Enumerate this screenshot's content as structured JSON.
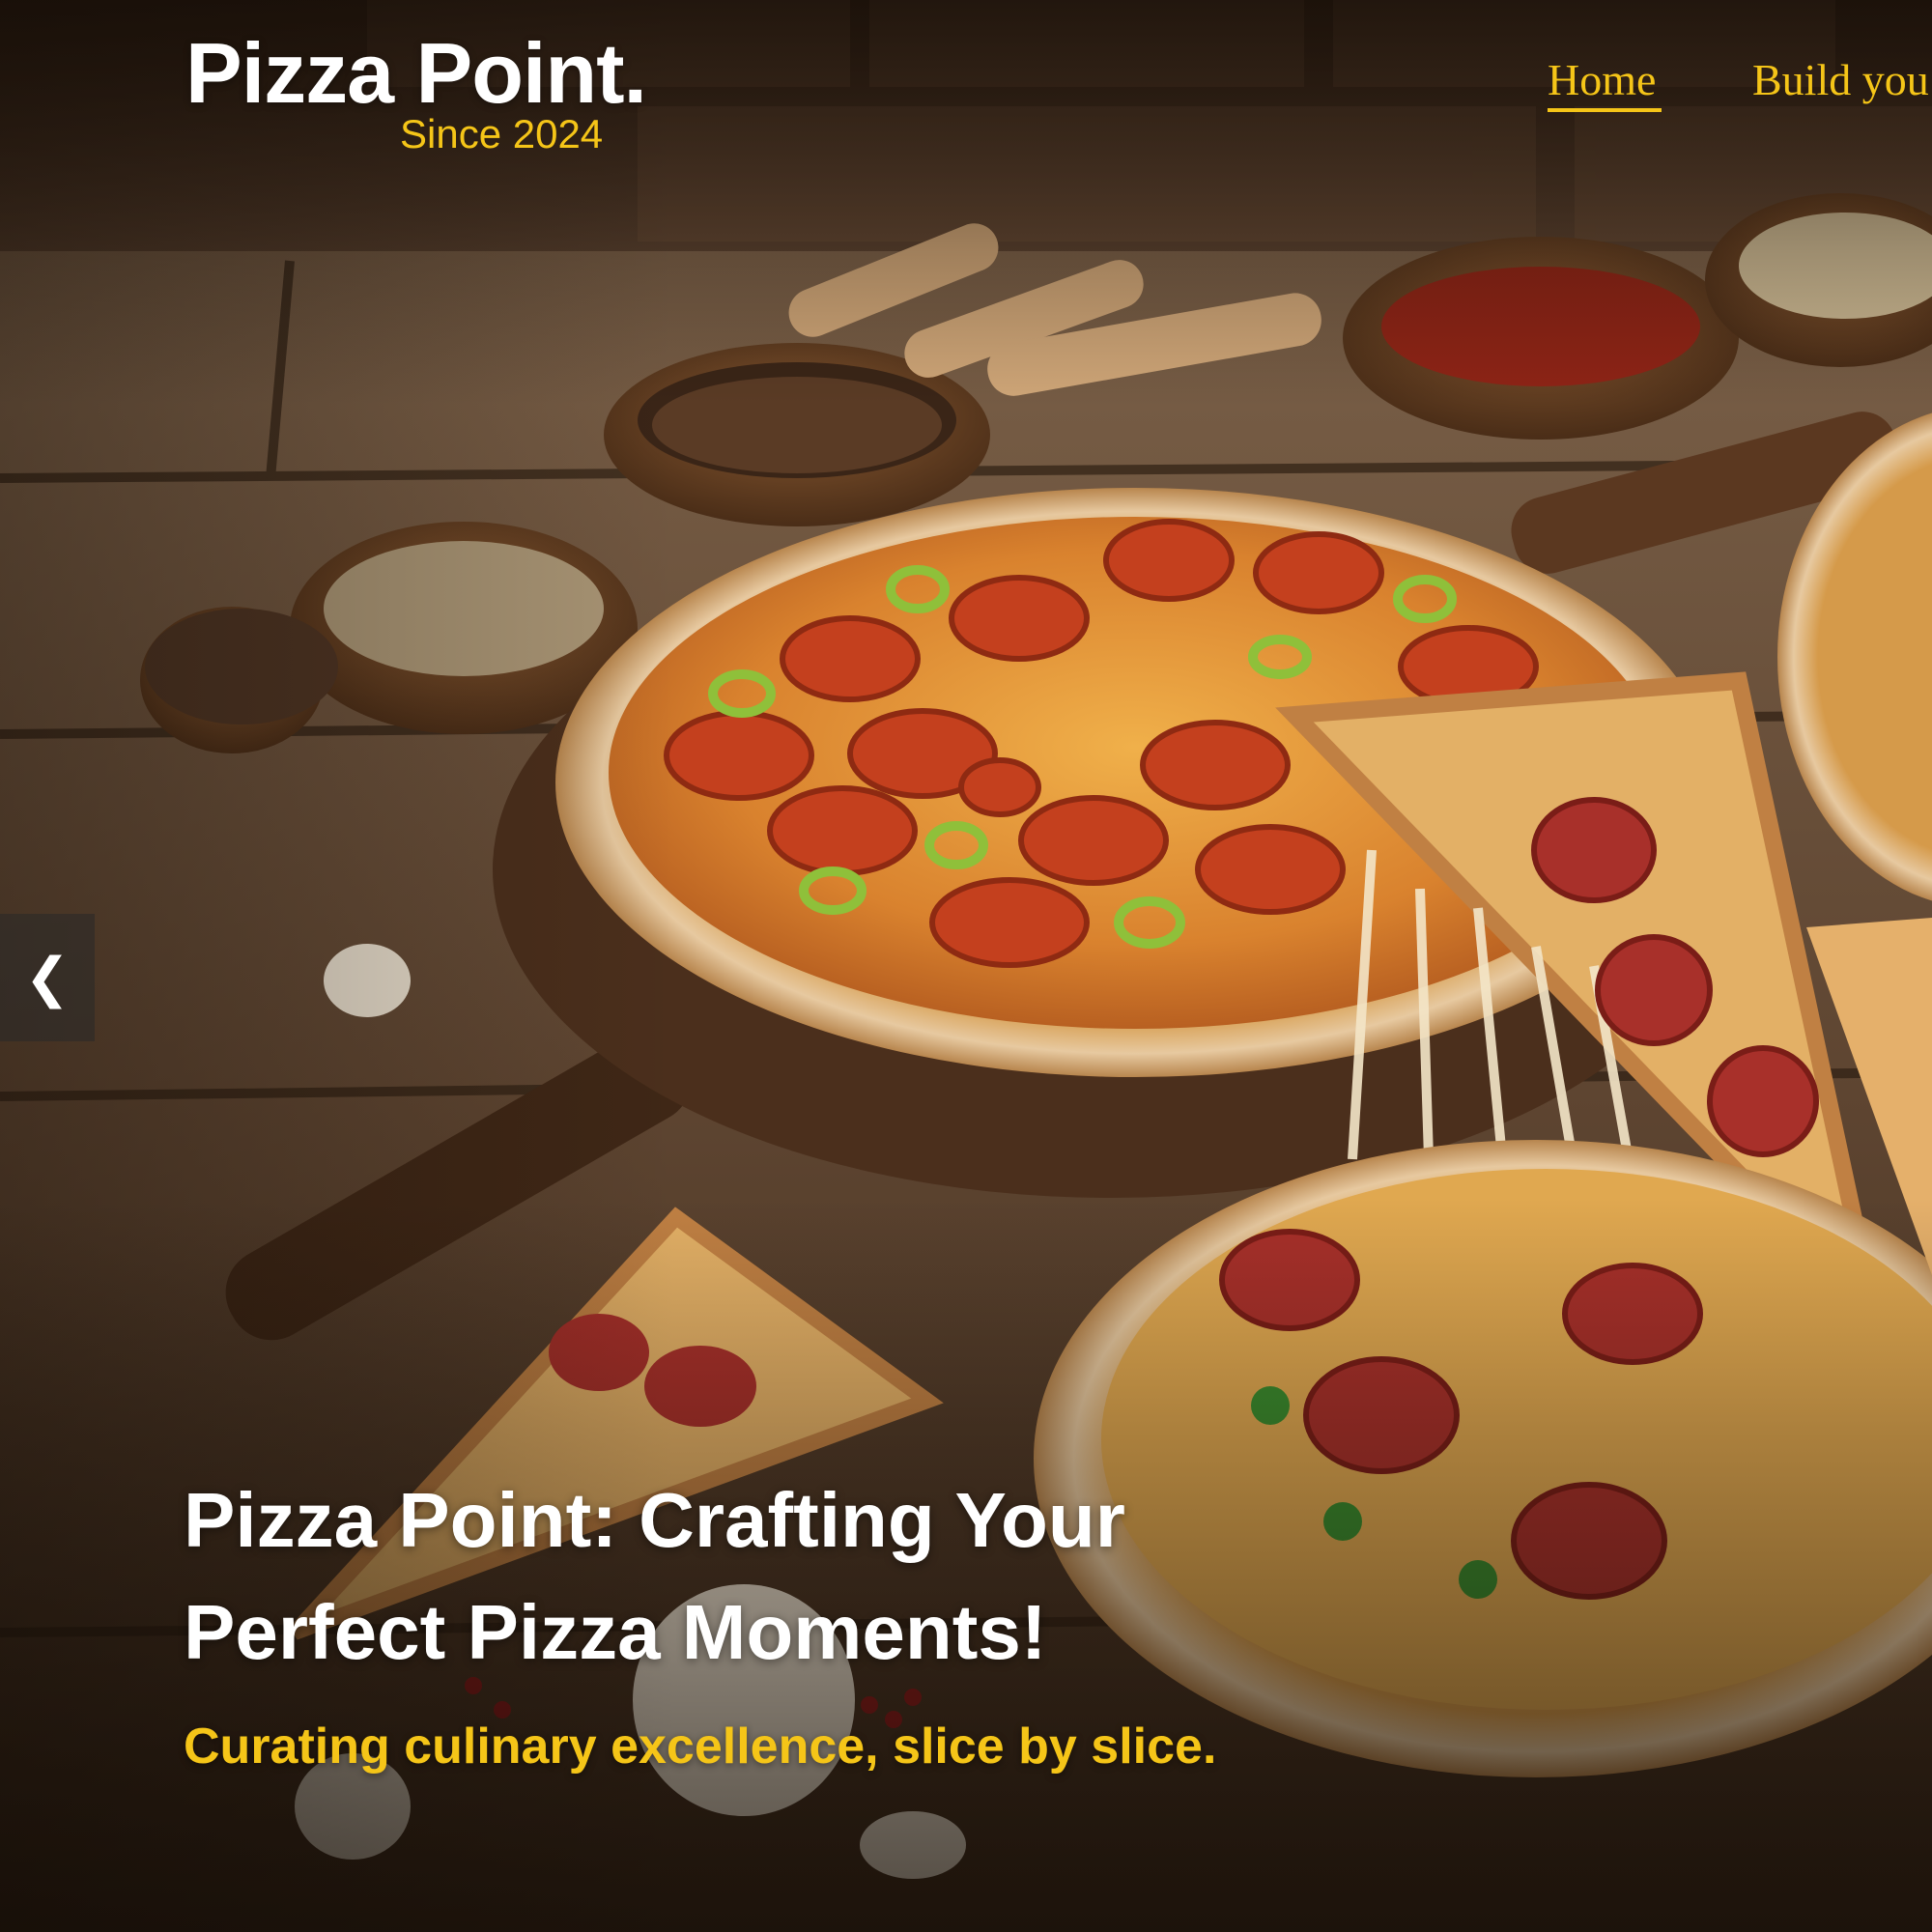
{
  "header": {
    "brand_name": "Pizza Point.",
    "brand_tagline": "Since 2024",
    "nav": [
      {
        "label": "Home",
        "active": true
      },
      {
        "label": "Build you"
      }
    ]
  },
  "hero": {
    "title": "Pizza Point: Crafting Your Perfect Pizza Moments!",
    "subtitle": "Curating culinary excellence, slice by slice.",
    "prev_icon": "chevron-left-icon"
  },
  "colors": {
    "accent": "#f5c518",
    "text_light": "#ffffff",
    "overlay": "#140c06"
  }
}
